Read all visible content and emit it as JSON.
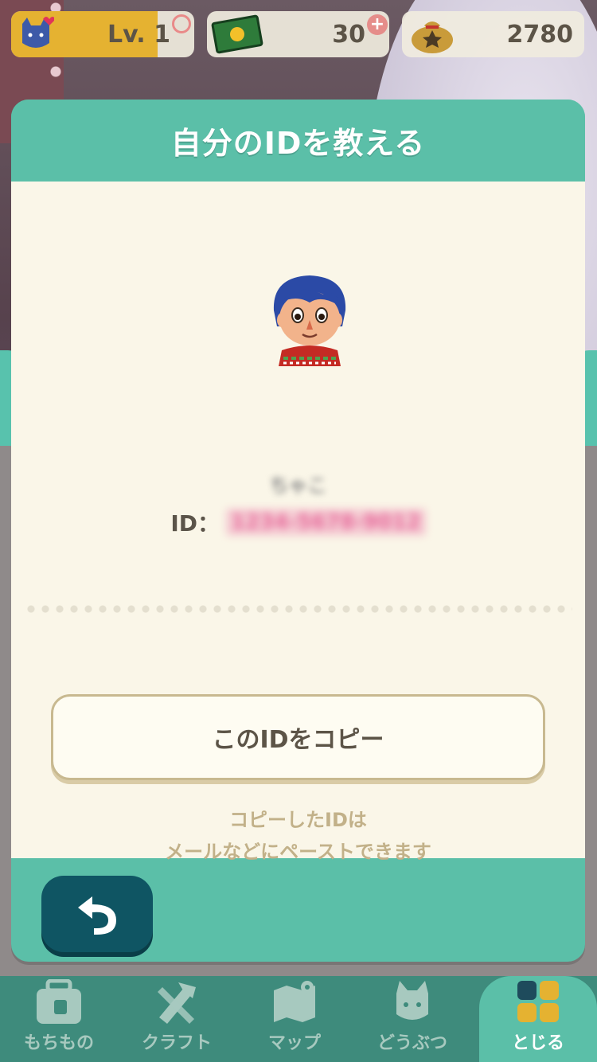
{
  "hud": {
    "level_label": "Lv. 1",
    "leaf_tickets": "30",
    "bells": "2780"
  },
  "modal": {
    "title": "自分のIDを教える",
    "player_name": "ちゃこ",
    "id_label": "ID：",
    "id_value": "1234-5678-9012",
    "copy_button": "このIDをコピー",
    "hint_line1": "コピーしたIDは",
    "hint_line2": "メールなどにペーストできます"
  },
  "nav": {
    "items": [
      {
        "label": "もちもの",
        "icon": "bag-icon"
      },
      {
        "label": "クラフト",
        "icon": "craft-icon"
      },
      {
        "label": "マップ",
        "icon": "map-icon"
      },
      {
        "label": "どうぶつ",
        "icon": "animal-icon"
      },
      {
        "label": "とじる",
        "icon": "close-grid-icon"
      }
    ]
  },
  "colors": {
    "accent": "#5bbfa8",
    "panel": "#faf6e8",
    "back_button": "#0f5563",
    "nav_bg": "#3e8b7c"
  }
}
